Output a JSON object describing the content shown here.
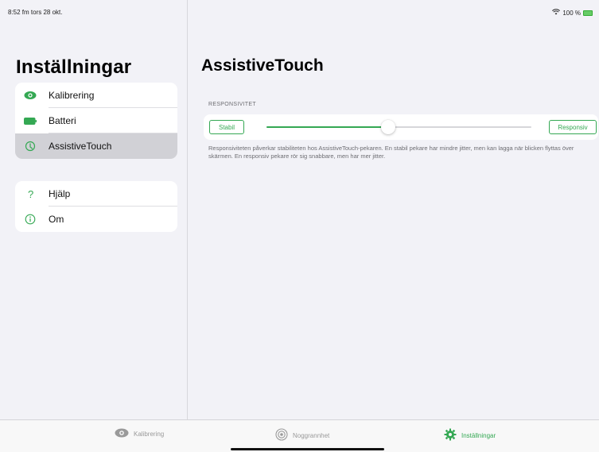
{
  "status_bar": {
    "time_date": "8:52 fm  tors 28 okt.",
    "battery": "100 %"
  },
  "sidebar": {
    "title": "Inställningar",
    "group1": [
      {
        "label": "Kalibrering",
        "icon": "eye-icon"
      },
      {
        "label": "Batteri",
        "icon": "battery-icon"
      },
      {
        "label": "AssistiveTouch",
        "icon": "assistivetouch-icon",
        "selected": true
      }
    ],
    "group2": [
      {
        "label": "Hjälp",
        "icon": "question-icon"
      },
      {
        "label": "Om",
        "icon": "info-icon"
      }
    ]
  },
  "detail": {
    "title": "AssistiveTouch",
    "section_header": "RESPONSIVITET",
    "slider": {
      "left_label": "Stabil",
      "right_label": "Responsiv",
      "value": 0.46
    },
    "footer": "Responsiviteten påverkar stabiliteten hos AssistiveTouch-pekaren. En stabil pekare har mindre jitter, men kan lagga när blicken flyttas över skärmen. En responsiv pekare rör sig snabbare, men har mer jitter."
  },
  "tabbar": {
    "tabs": [
      {
        "label": "Kalibrering",
        "icon": "eye-icon"
      },
      {
        "label": "Noggrannhet",
        "icon": "target-icon"
      },
      {
        "label": "Inställningar",
        "icon": "gear-icon",
        "active": true
      }
    ]
  },
  "colors": {
    "accent": "#34a853",
    "background": "#f2f2f7",
    "selected_row": "#d1d1d6"
  }
}
